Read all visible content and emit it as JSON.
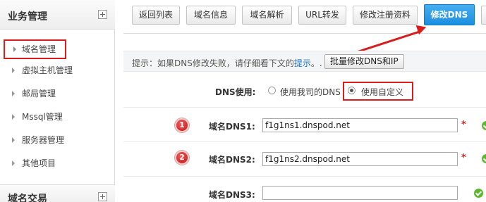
{
  "sidebar": {
    "section_title": "业务管理",
    "items": [
      {
        "label": "域名管理"
      },
      {
        "label": "虚拟主机管理"
      },
      {
        "label": "邮局管理"
      },
      {
        "label": "Mssql管理"
      },
      {
        "label": "服务器管理"
      },
      {
        "label": "其他项目"
      }
    ],
    "section2_title": "域名交易"
  },
  "toolbar": {
    "buttons": [
      {
        "label": "返回列表"
      },
      {
        "label": "域名信息"
      },
      {
        "label": "域名解析"
      },
      {
        "label": "URL转发"
      },
      {
        "label": "修改注册资料"
      },
      {
        "label": "修改DNS"
      }
    ]
  },
  "hint": {
    "prefix": "提示：如果DNS修改失败，请仔细看下文的",
    "link": "提示",
    "suffix": "。.",
    "button": "批量修改DNS和IP"
  },
  "dns_use": {
    "label": "DNS使用:",
    "option1": "使用我司的DNS",
    "option2": "使用自定义"
  },
  "dns1": {
    "badge": "1",
    "label": "域名DNS1:",
    "value": "f1g1ns1.dnspod.net",
    "star": "*"
  },
  "dns2": {
    "badge": "2",
    "label": "域名DNS2:",
    "value": "f1g1ns2.dnspod.net",
    "star": "*"
  },
  "dns3": {
    "label": "域名DNS3:",
    "value": ""
  },
  "colors": {
    "accent": "#1b8ee0",
    "highlight": "#d91d1d",
    "ok": "#5cb82e"
  }
}
